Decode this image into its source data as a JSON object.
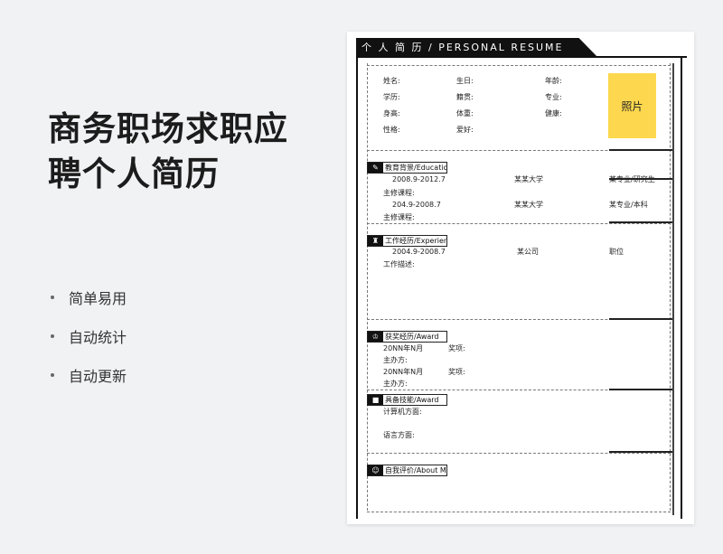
{
  "hero": {
    "title_line1": "商务职场求职应",
    "title_line2": "聘个人简历"
  },
  "features": [
    "简单易用",
    "自动统计",
    "自动更新"
  ],
  "resume": {
    "header": "个 人 简 历 / PERSONAL   RESUME",
    "photo": "照片",
    "basic": {
      "name": "姓名:",
      "birthday": "生日:",
      "age": "年龄:",
      "degree": "学历:",
      "origin": "籍贯:",
      "major": "专业:",
      "height": "身高:",
      "weight": "体重:",
      "health": "健康:",
      "personality": "性格:",
      "hobby": "爱好:"
    },
    "education": {
      "title": "教育背景/Education",
      "icon": "graduation-icon",
      "rows": [
        {
          "period": "2008.9-2012.7",
          "school": "某某大学",
          "major": "某专业/研究生",
          "courses": "主修课程:"
        },
        {
          "period": "204.9-2008.7",
          "school": "某某大学",
          "major": "某专业/本科",
          "courses": "主修课程:"
        }
      ]
    },
    "work": {
      "title": "工作经历/Experience",
      "icon": "briefcase-icon",
      "period": "2004.9-2008.7",
      "company": "某公司",
      "position": "职位",
      "desc": "工作描述:"
    },
    "award": {
      "title": "获奖经历/Award",
      "icon": "trophy-icon",
      "rows": [
        {
          "date": "20NN年N月",
          "item": "奖项:",
          "host": "主办方:"
        },
        {
          "date": "20NN年N月",
          "item": "奖项:",
          "host": "主办方:"
        }
      ]
    },
    "skills": {
      "title": "具备技能/Award",
      "icon": "skills-icon",
      "computer": "计算机方面:",
      "language": "语言方面:"
    },
    "self": {
      "title": "自我评价/About Me",
      "icon": "person-icon"
    }
  },
  "colors": {
    "photo_bg": "#fdd84e",
    "dark": "#111111",
    "page_bg": "#f1f2f4"
  }
}
